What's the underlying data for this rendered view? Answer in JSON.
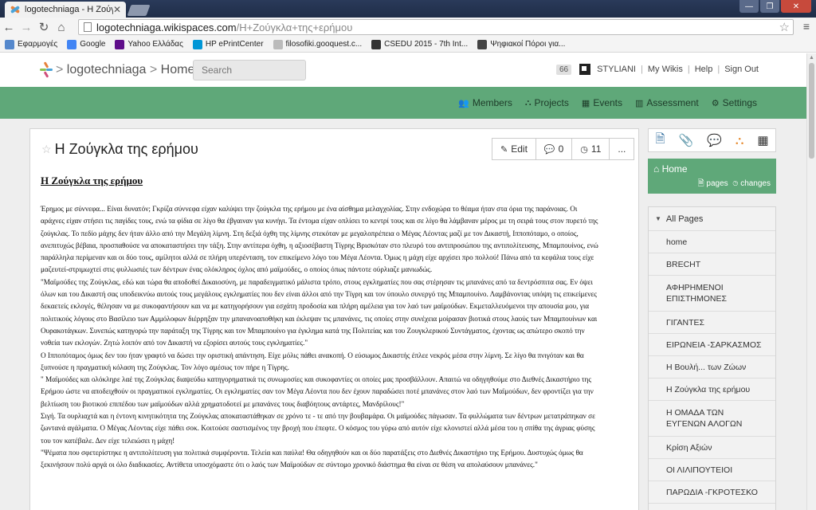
{
  "browser": {
    "tab_title": "logotechniaga - Η Ζούγκλ",
    "tab_close": "✕",
    "url_host": "logotechniaga.wikispaces.com",
    "url_path": "/Η+Ζούγκλα+της+ερήμου",
    "bookmarks": [
      {
        "label": "Εφαρμογές",
        "icon": "apps-icon",
        "color": "#5588cc"
      },
      {
        "label": "Google",
        "icon": "google-icon",
        "color": "#4285f4"
      },
      {
        "label": "Yahoo Ελλάδας",
        "icon": "yahoo-icon",
        "color": "#5f0e8a"
      },
      {
        "label": "HP ePrintCenter",
        "icon": "hp-icon",
        "color": "#0096d6"
      },
      {
        "label": "filosofiki.gooquest.c...",
        "icon": "page-icon",
        "color": "#bbbbbb"
      },
      {
        "label": "CSEDU 2015 - 7th Int...",
        "icon": "csedu-icon",
        "color": "#333333"
      },
      {
        "label": "Ψηφιακοί Πόροι για...",
        "icon": "bookmark-icon",
        "color": "#444444"
      }
    ]
  },
  "header": {
    "wiki": "logotechniaga",
    "page": "Home",
    "search_placeholder": "Search",
    "count": "66",
    "user": "STYLIANI",
    "my_wikis": "My Wikis",
    "help": "Help",
    "sign_out": "Sign Out"
  },
  "nav": [
    {
      "label": "Members",
      "icon": "members-icon",
      "glyph": "👥"
    },
    {
      "label": "Projects",
      "icon": "projects-icon",
      "glyph": "⛬"
    },
    {
      "label": "Events",
      "icon": "calendar-icon",
      "glyph": "▦"
    },
    {
      "label": "Assessment",
      "icon": "chart-icon",
      "glyph": "▥"
    },
    {
      "label": "Settings",
      "icon": "gear-icon",
      "glyph": "⚙"
    }
  ],
  "page": {
    "title": "Η Ζούγκλα της ερήμου",
    "edit": "Edit",
    "comments": "0",
    "history": "11",
    "more": "...",
    "doc_title": "Η Ζούγκλα της ερήμου",
    "paragraphs": [
      "Έρημος με σύννεφα... Είναι δυνατόν; Γκρίζα σύννεφα είχαν καλύψει την ζούγκλα της ερήμου με ένα αίσθημα μελαγχολίας. Στην ενδοχώρα το θέαμα ήταν στα όρια της παράνοιας. Οι αράχνες είχαν στήσει τις παγίδες τους, ενώ τα φίδια σε λίγο θα έβγαιναν για κυνήγι. Τα έντομα είχαν οπλίσει το κεντρί τους και σε λίγο θα λάμβαναν μέρος με τη σειρά τους στον πυρετό της ζούγκλας. Το πεδίο μάχης δεν ήταν άλλο από την Μεγάλη λίμνη. Στη δεξιά όχθη της λίμνης στεκόταν με μεγαλοπρέπεια ο Μέγας Λέοντας μαζί με τον Δικαστή, Ιπποπόταμο, ο οποίος, ανεπιτυχώς βέβαια, προσπαθούσε να αποκαταστήσει την τάξη. Στην αντίπερα όχθη, η αξιοσέβαστη Τίγρης Βρισκόταν στο πλευρό του αντιπροσώπου της αντιπολίτευσης, Μπαμπουίνος, ενώ παράλληλα περίμεναν και οι δύο τους, αμίλητοι αλλά σε πλήρη υπερένταση, τον επικείμενο λόγο του Μέγα Λέοντα. Όμως η μάχη είχε αρχίσει προ πολλού! Πάνω από τα κεφάλια τους είχε μαζευτεί-στριμωχτεί στις φυλλωσιές των δέντρων ένας ολόκληρος όχλος από μαϊμούδες, ο οποίος όπως πάντοτε ούρλιαζε μανιωδώς.",
      "\"Μαϊμούδες της Ζούγκλας, εδώ και τώρα θα αποδοθεί Δικαιοσύνη, με παραδειγματικό μάλιστα τρόπο, στους εγκληματίες που σας στέρησαν τις μπανάνες από τα δεντρόσπιτα σας. Εν όψει όλων και του Δικαστή σας υποδεικνύω αυτούς τους μεγάλους εγκληματίες που δεν είναι άλλοι από την Τίγρη και τον ύπουλο συνεργό της Μπαμπουίνο. Λαμβάνοντας υπόψη τις επικείμενες δεκαετείς εκλογές, θέλησαν να με συκοφαντήσουν και να με κατηγορήσουν για εσχάτη προδοσία και πλήρη αμέλεια για τον λαό των μαϊμούδων. Εκμεταλλευόμενοι την απουσία μου, για πολιτικούς λόγους στο Βασίλειο των Αμμόλοφων διέρρηξαν την μπανανοαποθήκη και έκλεψαν τις μπανάνες, τις οποίες στην συνέχεια μοίρασαν βιοτικά στους λαούς των Μπαμπουίνων και Ουρακοτάγκων. Συνεπώς κατηγορώ την παράταξη της Τίγρης και τον Μπαμπουίνο για έγκλημα κατά της Πολιτείας και του Ζουγκλερικού Συντάγματος, έχοντας ως απώτερο σκοπό την νοθεία των εκλογών. Ζητώ λοιπόν από τον Δικαστή να εξορίσει αυτούς τους εγκληματίες.\"",
      "Ο Ιπποπόταμος όμως δεν του ήταν γραφτό να δώσει την οριστική απάντηση. Είχε μόλις πάθει ανακοπή. Ο εύσωμος Δικαστής έπλεε νεκρός μέσα στην λίμνη. Σε λίγο θα πνιγόταν και θα ξυπνούσε η πραγματική κόλαση της Ζούγκλας. Τον λόγο αμέσως τον πήρε η Τίγρης.",
      "\" Μαϊμούδες και ολόκληρε λαέ της Ζούγκλας διαψεύδω κατηγορηματικά τις συνωμοσίες και συκοφαντίες οι οποίες μας προσβάλλουν. Απαιτώ να οδηγηθούμε στο Διεθνές Δικαστήριο της Ερήμου ώστε να αποδειχθούν οι πραγματικοί εγκληματίες. Οι εγκληματίες σαν τον Μέγα Λέοντα που δεν έχουν παραδώσει ποτέ μπανάνες στον λαό των Μαϊμούδων, δεν φροντίζει για την βελτίωση του βιοτικού επιπέδου των μαϊμούδων αλλά χρηματοδοτεί με μπανάνες τους διαβόητους αντάρτες, Μανδρίλους!\"",
      "Σιγή. Τα ουρλιαχτά και η έντονη κινητικότητα της Ζούγκλας αποκαταστάθηκαν σε χρόνο τε - τε από την βουβαμάρα. Οι μαϊμούδες πάγωσαν. Τα φυλλώματα των δέντρων μετατράπηκαν σε ζωντανά αγάλματα. Ο Μέγας Λέοντας είχε πάθει σοκ. Κοιτούσε σαστισμένος την βροχή που έπεφτε. Ο κόσμος του γύρω από αυτόν είχε κλονιστεί αλλά μέσα του η σπίθα της άγριας φύσης του τον κατέβαλε. Δεν είχε τελειώσει η μάχη!",
      "\"Ψέματα που σφετερίστηκε η αντιπολίτευση για πολιτικά συμφέροντα. Τελεία και παύλα! Θα οδηγηθούν και οι δύο παρατάξεις στο Διεθνές Δικαστήριο της Ερήμου. Δυστυχώς όμως θα ξεκινήσουν πολύ αργά οι όλο διαδικασίες. Αντίθετα υποσχόμαστε ότι ο λαός των Μαϊμούδων σε σύντομο χρονικό διάστημα θα είναι σε θέση να απολαύσουν μπανάνες.\""
    ]
  },
  "sidebar": {
    "icons": [
      {
        "icon": "page-icon",
        "glyph": "🗎",
        "color": "#2d6b9c"
      },
      {
        "icon": "attachment-icon",
        "glyph": "📎",
        "color": "#3b8f3b"
      },
      {
        "icon": "comment-icon",
        "glyph": "💬",
        "color": "#d7612a"
      },
      {
        "icon": "hierarchy-icon",
        "glyph": "⛬",
        "color": "#e68a2e"
      },
      {
        "icon": "calendar-icon",
        "glyph": "▦",
        "color": "#333333"
      }
    ],
    "home": "Home",
    "pages_link": "pages",
    "changes_link": "changes",
    "all_pages": "All Pages",
    "items": [
      "home",
      "BRECHT",
      "ΑΦΗΡΗΜΕΝΟΙ ΕΠΙΣΤΗΜΟΝΕΣ",
      "ΓΙΓΑΝΤΕΣ",
      "ΕΙΡΩΝΕΙΑ -ΣΑΡΚΑΣΜΟΣ",
      "Η Βουλή... των Ζώων",
      "Η Ζούγκλα της ερήμου",
      "Η ΟΜΑΔΑ ΤΩΝ ΕΥΓΕΝΩΝ ΑΛΟΓΩΝ",
      "Κρίση Αξιών",
      "ΟΙ ΛΙΛΙΠΟΥΤΕΙΟΙ",
      "ΠΑΡΩΔΙΑ -ΓΚΡΟΤΕΣΚΟ"
    ]
  }
}
